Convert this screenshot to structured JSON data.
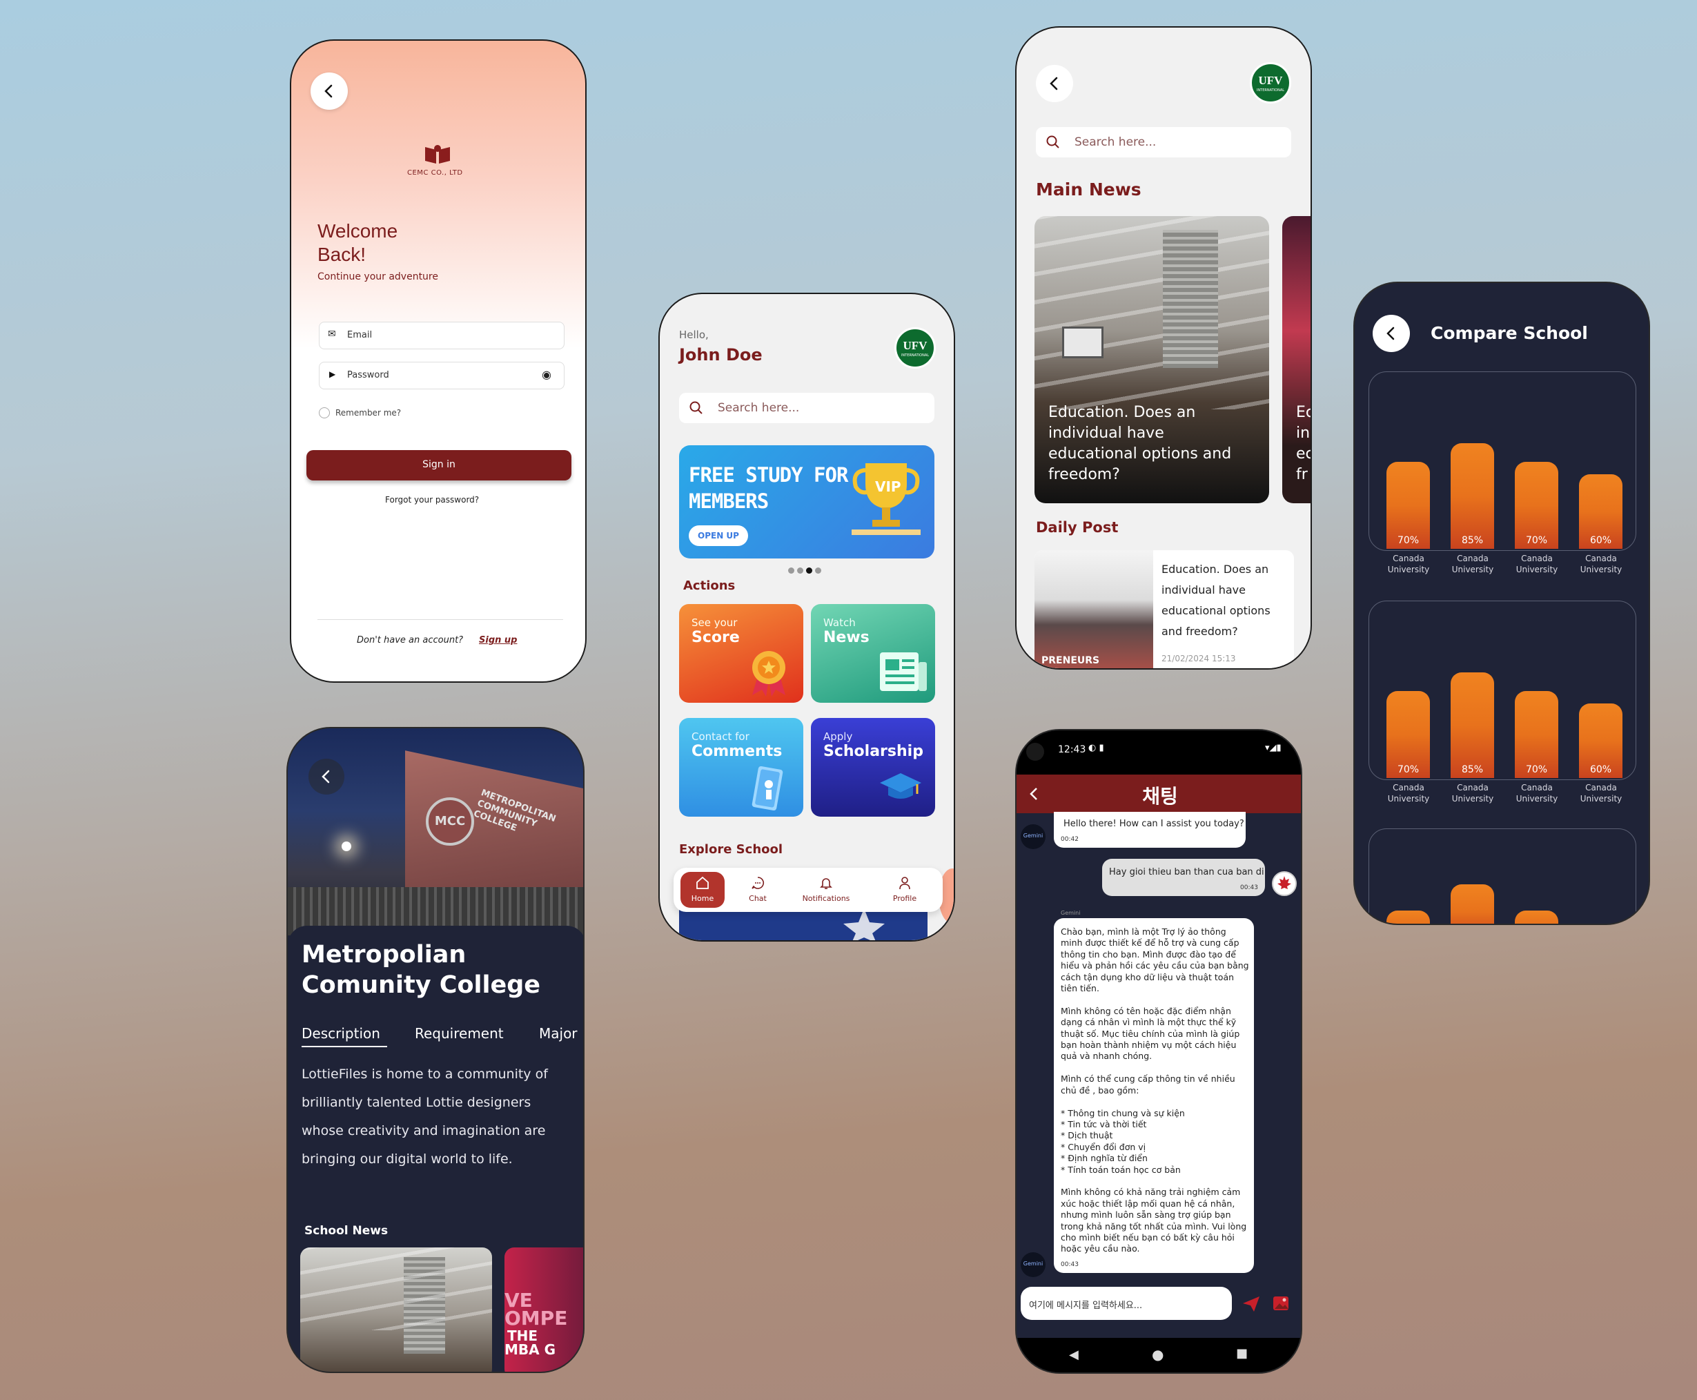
{
  "login": {
    "company": "CEMC CO., LTD",
    "title_line1": "Welcome",
    "title_line2": "Back!",
    "subtitle": "Continue your adventure",
    "email_placeholder": "Email",
    "password_placeholder": "Password",
    "remember": "Remember me?",
    "signin": "Sign in",
    "forgot": "Forgot your password?",
    "no_account": "Don't have an account?",
    "signup": "Sign up"
  },
  "home": {
    "greeting": "Hello,",
    "name": "John Doe",
    "logo": "UFV",
    "logo_sub": "INTERNATIONAL",
    "search_placeholder": "Search here...",
    "banner_line1": "FREE STUDY FOR",
    "banner_line2": "MEMBERS",
    "banner_button": "OPEN UP",
    "banner_badge": "VIP",
    "actions_title": "Actions",
    "tiles": [
      {
        "small": "See your",
        "big": "Score"
      },
      {
        "small": "Watch",
        "big": "News"
      },
      {
        "small": "Contact for",
        "big": "Comments"
      },
      {
        "small": "Apply",
        "big": "Scholarship"
      }
    ],
    "explore_title": "Explore School",
    "nav": [
      "Home",
      "Chat",
      "Notifications",
      "Profile"
    ]
  },
  "news": {
    "search_placeholder": "Search here...",
    "main_title": "Main News",
    "card_title": "Education. Does an individual have educational options and freedom?",
    "peek_text": [
      "Ec",
      "in",
      "ec",
      "fr"
    ],
    "daily_title": "Daily Post",
    "post_lines": [
      "Education. Does an",
      "individual have",
      "educational options",
      "and freedom?"
    ],
    "post_date": "21/02/2024 15:13",
    "post_img_text": "PRENEURS"
  },
  "compare": {
    "title": "Compare School",
    "charts": [
      {
        "type": "bar",
        "categories": [
          "Canada University",
          "Canada University",
          "Canada University",
          "Canada University"
        ],
        "values": [
          70,
          85,
          70,
          60
        ]
      },
      {
        "type": "bar",
        "categories": [
          "Canada University",
          "Canada University",
          "Canada University",
          "Canada University"
        ],
        "values": [
          70,
          85,
          70,
          60
        ]
      }
    ],
    "labels": [
      "70%",
      "85%",
      "70%",
      "60%"
    ]
  },
  "college": {
    "title_line1": "Metropolian",
    "title_line2": "Comunity College",
    "tabs": [
      "Description",
      "Requirement",
      "Major"
    ],
    "description": [
      "LottieFiles is home to a community of",
      "brilliantly talented Lottie designers",
      "whose creativity and imagination are",
      "bringing our digital world to life."
    ],
    "school_news": "School News",
    "building_sign": "METROPOLITAN COMMUNITY COLLEGE",
    "building_logo": "MCC",
    "thumb_text": [
      "VE",
      "OMPE",
      "THE",
      "MBA G"
    ]
  },
  "chat": {
    "time": "12:43",
    "title": "채팅",
    "msg1": "Hello there! How can I assist you today?",
    "msg1_time": "00:42",
    "msg2": "Hay gioi thieu ban than cua ban di",
    "msg2_time": "00:43",
    "sender": "Gemini",
    "avatar_text": "Gemini",
    "msg3": [
      "Chào bạn, mình là một Trợ lý ảo thông",
      "minh được thiết kế  để hỗ trợ và cung cấp",
      "thông tin cho bạn. Mình được đào tạo để",
      "hiểu và phản hồi các yêu cầu của bạn bằng",
      "cách tận dụng kho dữ  liệu và thuật toán",
      "tiên tiến.",
      "",
      "Mình không có tên hoặc đặc điểm nhận",
      "dạng cá nhân vì mình là một thực thể kỹ",
      "thuật số. Mục tiêu chính của mình là giúp",
      "bạn hoàn thành nhiệm vụ một cách hiệu",
      "quả và nhanh chóng.",
      "",
      "Mình có thể cung cấp thông tin về nhiều",
      "chủ đề , bao gồm:",
      "",
      "* Thông tin chung và sự kiện",
      "* Tin tức và thời tiết",
      "* Dịch thuật",
      "* Chuyển đổi đơn vị",
      "* Định nghĩa từ điển",
      "* Tính toán toán học cơ bản",
      "",
      "Mình không có khả năng trải nghiệm cảm",
      "xúc hoặc thiết lập mối quan hệ cá nhân,",
      "nhưng mình luôn sẵn sàng trợ giúp bạn",
      "trong khả năng tốt nhất của mình. Vui lòng",
      "cho mình biết nếu bạn có bất kỳ câu hỏi",
      "hoặc yêu cầu nào."
    ],
    "msg3_time": "00:43",
    "input_placeholder": "여기에 메시지를 입력하세요..."
  },
  "colors": {
    "brand": "#7b1d1d",
    "accent": "#f08320",
    "dark": "#1f2337"
  }
}
